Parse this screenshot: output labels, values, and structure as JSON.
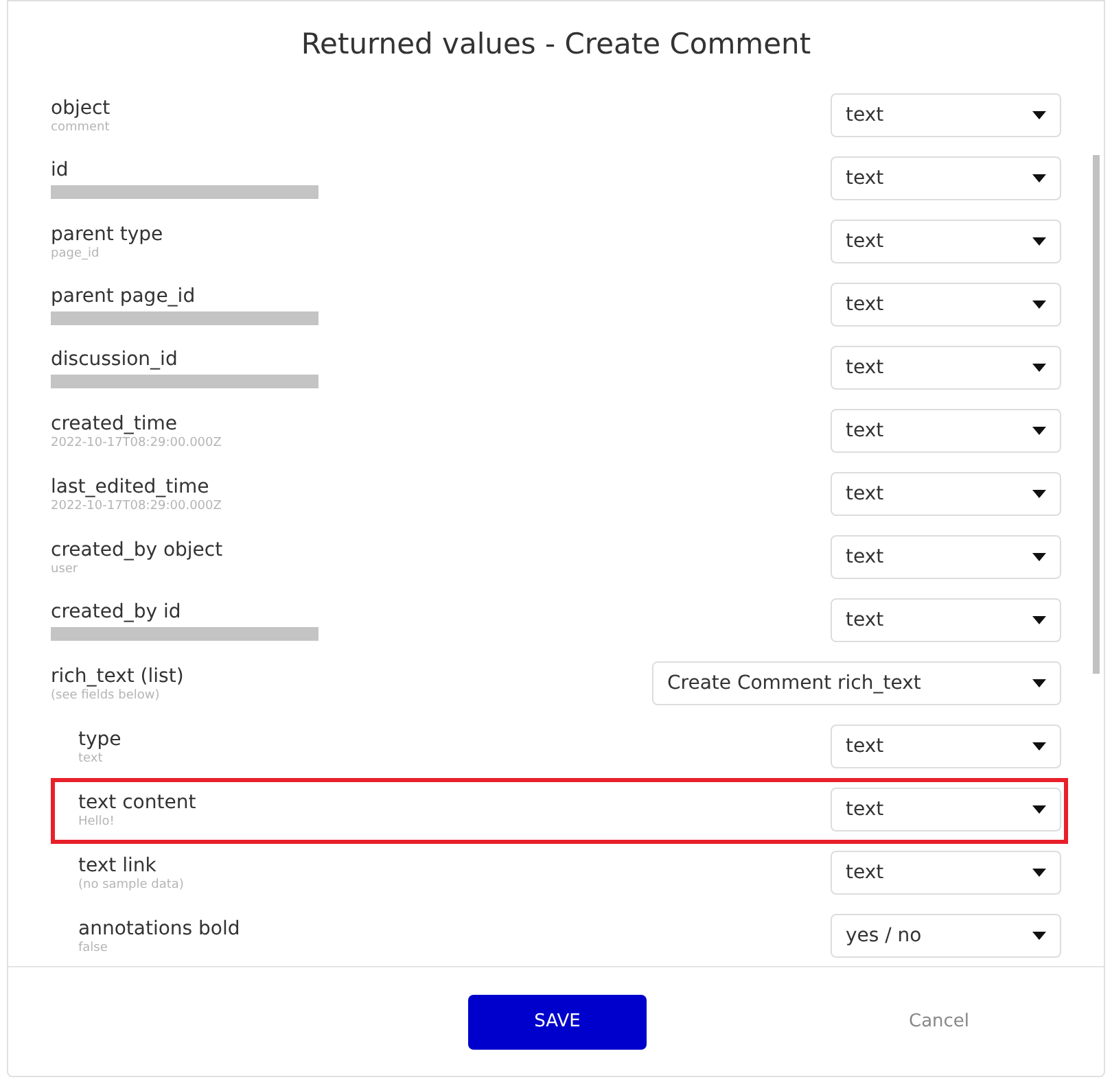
{
  "dialog": {
    "title": "Returned values - Create Comment"
  },
  "rows": [
    {
      "label": "object",
      "sample": "comment",
      "redacted": false,
      "type": "text",
      "highlighted": false
    },
    {
      "label": "id",
      "redacted": true,
      "type": "text",
      "highlighted": false
    },
    {
      "label": "parent type",
      "sample": "page_id",
      "redacted": false,
      "type": "text",
      "highlighted": false
    },
    {
      "label": "parent page_id",
      "redacted": true,
      "type": "text",
      "highlighted": false
    },
    {
      "label": "discussion_id",
      "redacted": true,
      "type": "text",
      "highlighted": false
    },
    {
      "label": "created_time",
      "sample": "2022-10-17T08:29:00.000Z",
      "redacted": false,
      "type": "text",
      "highlighted": false
    },
    {
      "label": "last_edited_time",
      "sample": "2022-10-17T08:29:00.000Z",
      "redacted": false,
      "type": "text",
      "highlighted": false
    },
    {
      "label": "created_by object",
      "sample": "user",
      "redacted": false,
      "type": "text",
      "highlighted": false
    },
    {
      "label": "created_by id",
      "redacted": true,
      "type": "text",
      "highlighted": false
    },
    {
      "label": "rich_text (list)",
      "sample": "(see fields below)",
      "redacted": false,
      "type": "Create Comment rich_text",
      "highlighted": false,
      "children": [
        {
          "label": "type",
          "sample": "text",
          "redacted": false,
          "type": "text",
          "highlighted": false
        },
        {
          "label": "text content",
          "sample": "Hello!",
          "redacted": false,
          "type": "text",
          "highlighted": true
        },
        {
          "label": "text link",
          "sample": "(no sample data)",
          "redacted": false,
          "type": "text",
          "highlighted": false
        },
        {
          "label": "annotations bold",
          "sample": "false",
          "redacted": false,
          "type": "yes / no",
          "highlighted": false
        }
      ]
    }
  ],
  "buttons": {
    "save": "SAVE",
    "cancel": "Cancel"
  }
}
